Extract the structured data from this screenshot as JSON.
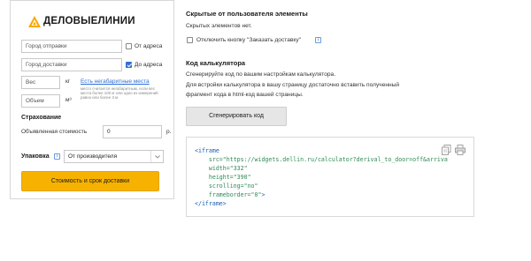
{
  "widget": {
    "logo_text": "ДЕЛОВЫЕЛИНИИ",
    "from": {
      "placeholder": "Город отправки",
      "checkbox_label": "От адреса",
      "checked": false
    },
    "to": {
      "placeholder": "Город доставки",
      "checkbox_label": "До адреса",
      "checked": true
    },
    "weight": {
      "placeholder": "Вес",
      "unit": "кг"
    },
    "volume": {
      "placeholder": "Объем",
      "unit": "м³"
    },
    "oversized_link": "Есть негабаритные места",
    "oversized_hint": "место считается негабаритным, если вес места более 100 кг или одно из измерений равно или более 3 м",
    "insurance": {
      "heading": "Страхование",
      "label": "Объявленная стоимость",
      "value": "0",
      "currency": "р."
    },
    "packaging": {
      "label": "Упаковка",
      "value": "От производителя"
    },
    "calc_button": "Стоимость и срок доставки"
  },
  "hidden": {
    "heading": "Скрытые от пользователя элементы",
    "none_text": "Скрытых элементов нет.",
    "disable_label": "Отключить кнопку \"Заказать доставку\""
  },
  "calculator_code": {
    "heading": "Код калькулятора",
    "line1": "Сгенерируйте код по вашим настройкам калькулятора.",
    "line2": "Для встройки калькулятора в вашу страницу достаточно вставить полученный",
    "line3": "фрагмент кода в html-код вашей страницы.",
    "generate_button": "Сгенерировать код",
    "code": {
      "open_tag": "<iframe",
      "src_attr": "src=",
      "src_val": "\"https://widgets.dellin.ru/calculator?derival_to_door=off&arriva",
      "width_attr": "width=",
      "width_val": "\"332\"",
      "height_attr": "height=",
      "height_val": "\"390\"",
      "scrolling_attr": "scrolling=",
      "scrolling_val": "\"no\"",
      "frameborder_attr": "frameborder=",
      "frameborder_val": "\"0\"",
      "close_bracket": ">",
      "close_tag": "</iframe>"
    }
  },
  "colors": {
    "accent": "#f7b200",
    "link": "#2e6fd6",
    "code_tag": "#1a5db5",
    "code_string": "#2e8a57"
  }
}
